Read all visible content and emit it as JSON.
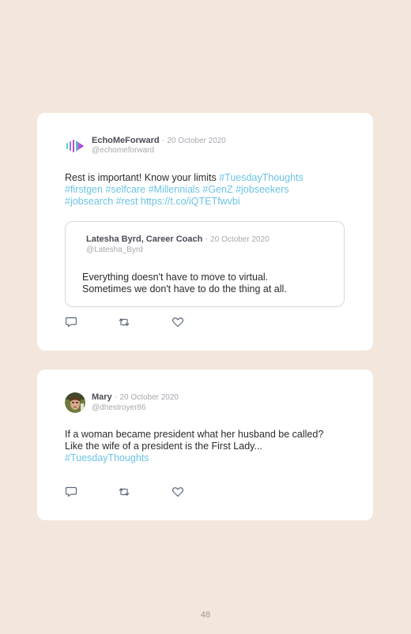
{
  "tweets": [
    {
      "author": "EchoMeForward",
      "date": "20 October 2020",
      "handle": "@echomeforward",
      "lines": [
        {
          "plain": "Rest is important! Know your limits ",
          "tags": "#TuesdayThoughts"
        },
        {
          "plain": "",
          "tags": "#firstgen #selfcare #Millennials #GenZ #jobseekers"
        },
        {
          "plain": "",
          "tags": "#jobsearch #rest https://t.co/iQTETfwvbi"
        }
      ],
      "quoted": {
        "author": "Latesha Byrd, Career Coach",
        "date": "20 October 2020",
        "handle": "@Latesha_Byrd",
        "lines": [
          "Everything doesn't have to move to virtual.",
          "Sometimes we don't have to do the thing at all."
        ]
      },
      "icons": {
        "reply": "reply-icon",
        "retweet": "retweet-icon",
        "like": "heart-icon"
      }
    },
    {
      "author": "Mary",
      "date": "20 October 2020",
      "handle": "@dhestroyer86",
      "lines": [
        {
          "plain": "If a woman became president what her husband be called?",
          "tags": ""
        },
        {
          "plain": "Like the wife of a president is the First Lady...",
          "tags": ""
        },
        {
          "plain": "",
          "tags": "#TuesdayThoughts"
        }
      ],
      "icons": {
        "reply": "reply-icon",
        "retweet": "retweet-icon",
        "like": "heart-icon"
      }
    }
  ],
  "separator": "·",
  "page_number": "48",
  "colors": {
    "background": "#f3e6dc",
    "card": "#ffffff",
    "hashtag": "#6cc3e4",
    "name": "#4b4b57",
    "muted": "#a8a8b0",
    "logo_gradient": [
      "#4fd1c5",
      "#7b3fe4"
    ]
  }
}
